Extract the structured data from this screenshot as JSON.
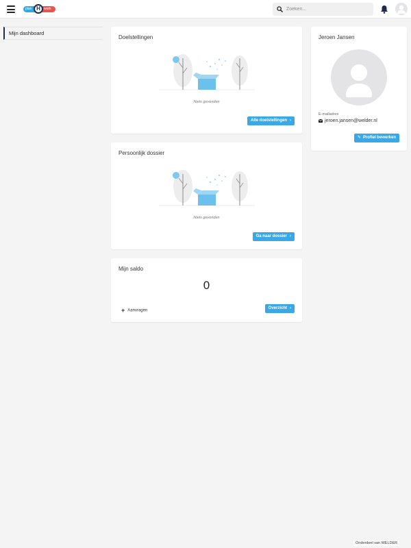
{
  "header": {
    "logo": {
      "left": "plan",
      "middle": "H",
      "right": "work"
    },
    "search": {
      "placeholder": "Zoeken...",
      "value": ""
    },
    "icons": {
      "menu": "hamburger-icon",
      "search": "search-icon",
      "notifications": "bell-icon",
      "user": "user-avatar-icon"
    }
  },
  "sidebar": {
    "items": [
      {
        "label": "Mijn dashboard",
        "active": true
      }
    ]
  },
  "cards": {
    "doelstellingen": {
      "title": "Doelstellingen",
      "empty": "Niets gevonden",
      "button": "Alle doelstellingen"
    },
    "dossier": {
      "title": "Persoonlijk dossier",
      "empty": "Niets gevonden",
      "button": "Ga naar dossier"
    },
    "saldo": {
      "title": "Mijn saldo",
      "value": "0",
      "request": "Aanvragen",
      "button": "Overzicht"
    }
  },
  "profile": {
    "name": "Jeroen Jansen",
    "email_label": "E-mailadres",
    "email": "jeroen.jansen@welder.nl",
    "button": "Profiel bewerken"
  },
  "footer": {
    "text": "Onderdeel van WELDER"
  },
  "colors": {
    "accent": "#3aa8e6",
    "navy": "#1f2b4d",
    "logo_red": "#e8554e",
    "background": "#f4f4f4"
  }
}
